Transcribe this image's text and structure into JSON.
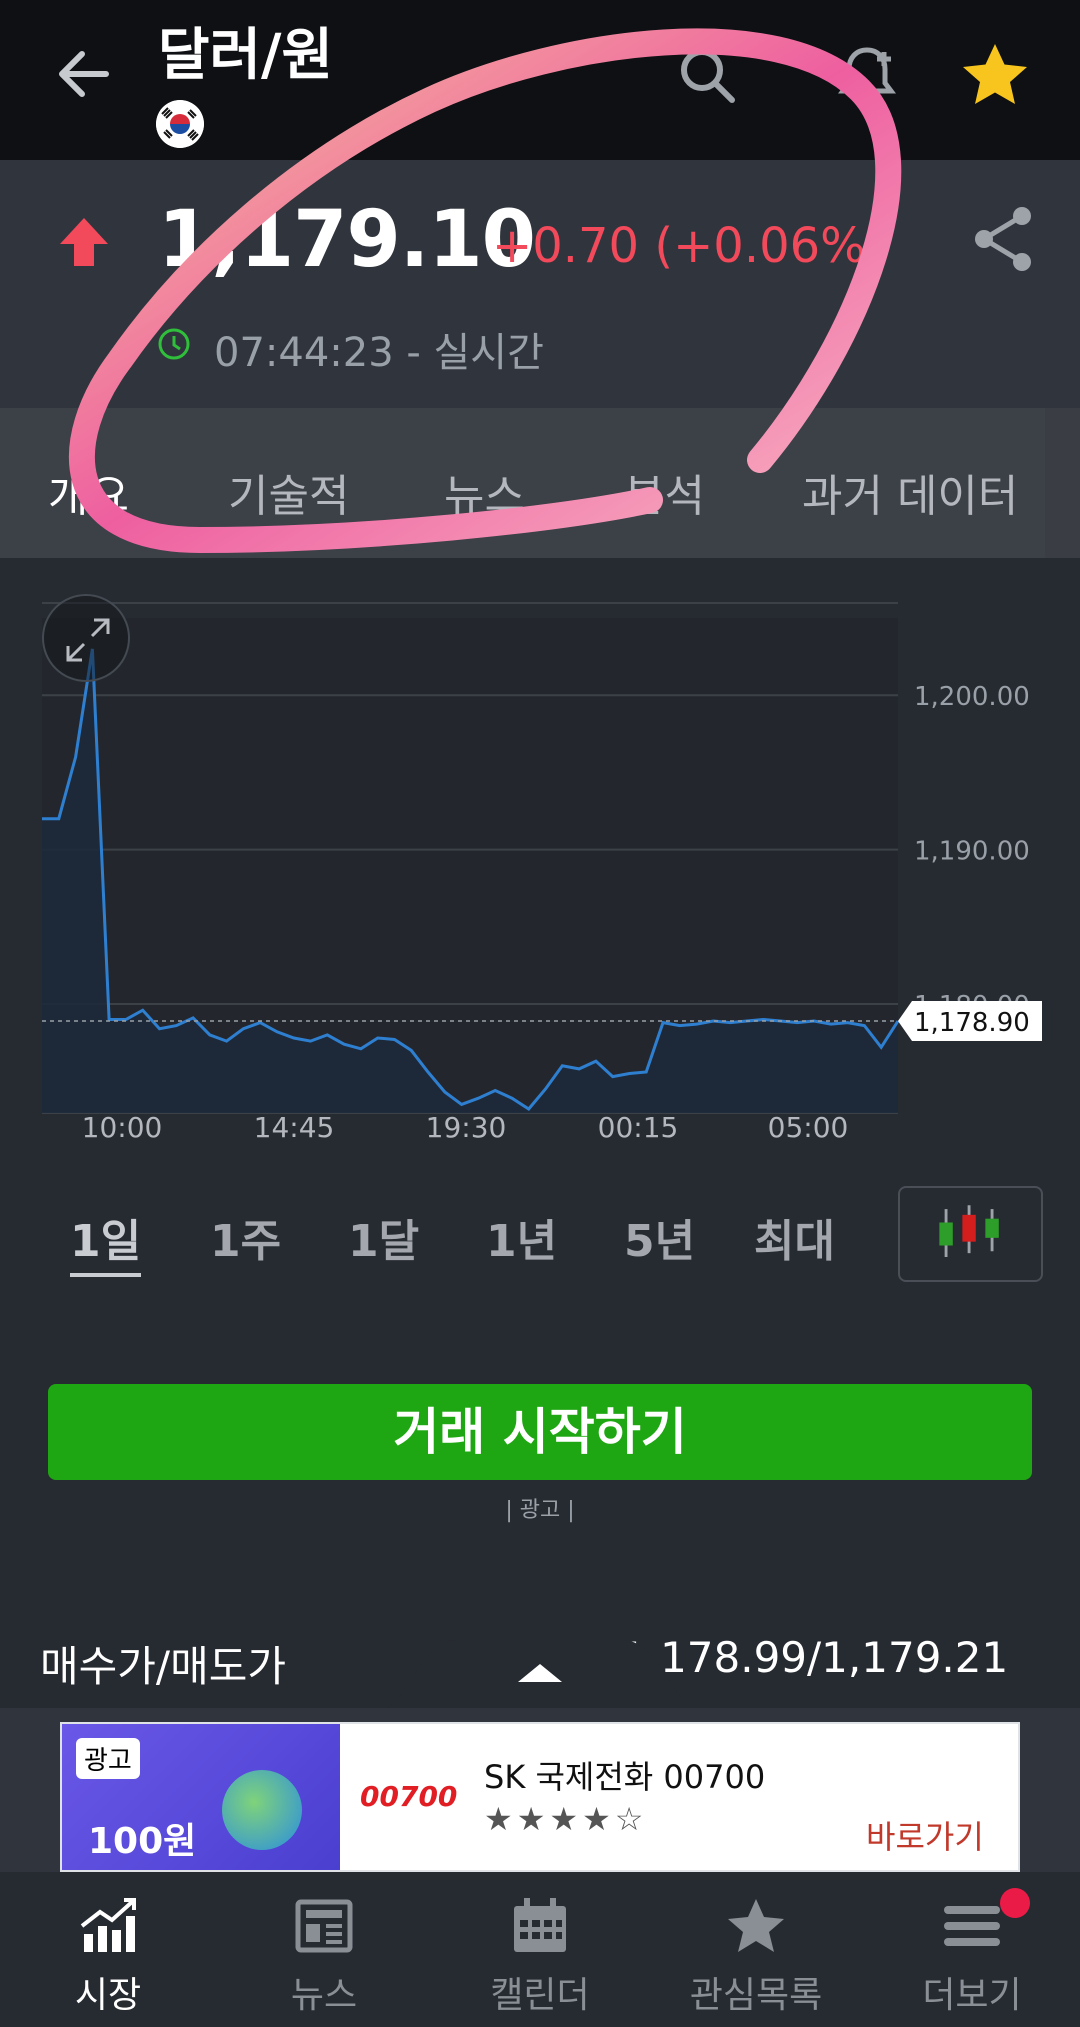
{
  "header": {
    "title": "달러/원",
    "back_icon": "arrow-left-icon",
    "search_icon": "search-icon",
    "alert_icon": "bell-plus-icon",
    "favorite_icon": "star-icon",
    "flag": "south-korea-flag"
  },
  "quote": {
    "price": "1,179.10",
    "change": "+0.70 (+0.06%)",
    "time": "07:44:23 - 실시간",
    "direction": "up",
    "up_color": "#f2495b"
  },
  "tabs": [
    "개요",
    "기술적",
    "뉴스",
    "분석",
    "과거 데이터"
  ],
  "chart_data": {
    "type": "area",
    "x_ticks": [
      "10:00",
      "14:45",
      "19:30",
      "00:15",
      "05:00"
    ],
    "y_ticks": [
      "1,200.00",
      "1,190.00",
      "1,180.00"
    ],
    "ylim": [
      1171,
      1205
    ],
    "last_value_label": "1,178.90",
    "reference_line": 1178.9,
    "series": [
      {
        "values": [
          1192,
          1192,
          1196,
          1203,
          1179,
          1179,
          1179.6,
          1178.4,
          1178.6,
          1179.1,
          1178,
          1177.6,
          1178.4,
          1178.8,
          1178.2,
          1177.8,
          1177.6,
          1178,
          1177.4,
          1177.1,
          1177.8,
          1177.7,
          1177,
          1175.6,
          1174.3,
          1173.5,
          1173.9,
          1174.4,
          1173.9,
          1173.2,
          1174.5,
          1176,
          1175.8,
          1176.3,
          1175.3,
          1175.5,
          1175.6,
          1178.8,
          1178.6,
          1178.7,
          1178.9,
          1178.8,
          1178.9,
          1179,
          1178.9,
          1178.8,
          1178.9,
          1178.7,
          1178.8,
          1178.6,
          1177.2,
          1178.9
        ]
      }
    ]
  },
  "ranges": {
    "items": [
      "1일",
      "1주",
      "1달",
      "1년",
      "5년",
      "최대"
    ],
    "active": "1일",
    "chart_type_icon": "candlestick-icon",
    "expand_icon": "expand-icon"
  },
  "cta": {
    "label": "거래 시작하기",
    "ad_label": "| 광고 |",
    "color": "#1ea712"
  },
  "bid_ask": {
    "label": "매수가/매도가",
    "value": "1,178.99/1,179.21"
  },
  "ad": {
    "tag": "광고",
    "title": "SK 국제전화 00700",
    "stars": "★★★★☆",
    "link": "바로가기",
    "image_text": "100원",
    "logo_text": "00700"
  },
  "nav": [
    {
      "label": "시장",
      "icon": "market-chart-icon",
      "active": true
    },
    {
      "label": "뉴스",
      "icon": "newspaper-icon",
      "active": false
    },
    {
      "label": "캘린더",
      "icon": "calendar-icon",
      "active": false
    },
    {
      "label": "관심목록",
      "icon": "star-icon",
      "active": false
    },
    {
      "label": "더보기",
      "icon": "menu-icon",
      "active": false
    }
  ]
}
